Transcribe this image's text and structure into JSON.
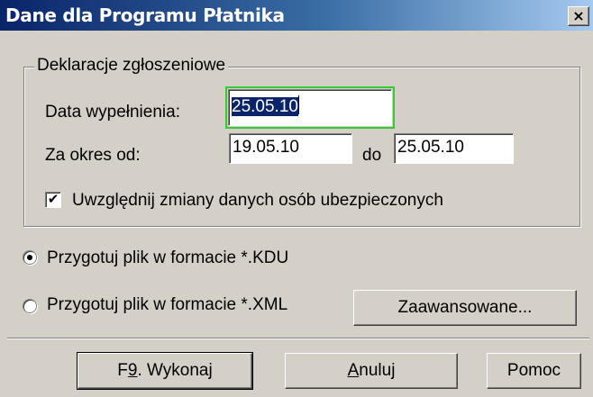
{
  "window": {
    "title": "Dane dla Programu Płatnika",
    "close_glyph": "×"
  },
  "declarations": {
    "legend": "Deklaracje zgłoszeniowe",
    "fill_date_label": "Data wypełnienia:",
    "fill_date_value": "25.05.10",
    "period_from_label": "Za okres od:",
    "period_from_value": "19.05.10",
    "period_to_label": "do",
    "period_to_value": "25.05.10",
    "include_changes_label": "Uwzględnij zmiany danych osób ubezpieczonych",
    "include_changes_checked": true,
    "check_glyph": "✔"
  },
  "format_options": [
    {
      "label": "Przygotuj plik w formacie *.KDU",
      "selected": true
    },
    {
      "label": "Przygotuj plik w formacie *.XML",
      "selected": false
    }
  ],
  "buttons": {
    "advanced": "Zaawansowane...",
    "execute_prefix": "F",
    "execute_mnemonic": "9",
    "execute_suffix": ". Wykonaj",
    "cancel_mnemonic": "A",
    "cancel_rest": "nuluj",
    "help": "Pomoc"
  },
  "colors": {
    "face": "#d4d0c8",
    "title_gradient_start": "#0a246a",
    "title_gradient_end": "#a6caf0",
    "focus_outline": "#33cc33"
  }
}
